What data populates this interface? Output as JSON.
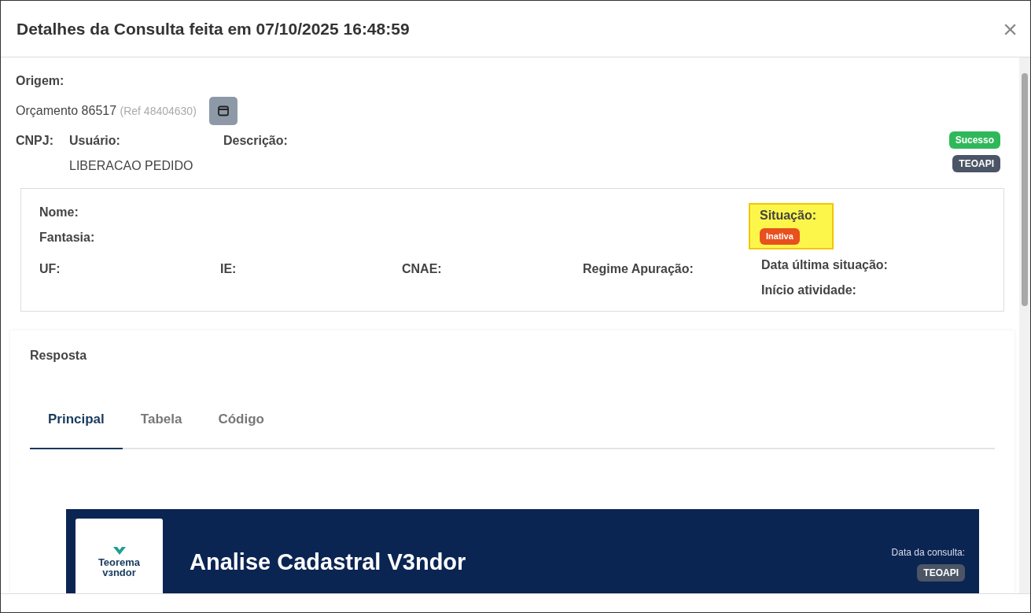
{
  "modal": {
    "title": "Detalhes da Consulta feita em 07/10/2025 16:48:59",
    "close": "×"
  },
  "origin": {
    "label": "Origem:",
    "value": "Orçamento 86517",
    "ref": "(Ref 48404630)"
  },
  "fields": [
    {
      "label": "CNPJ:"
    },
    {
      "label": "Usuário:",
      "value": "LIBERACAO PEDIDO"
    },
    {
      "label": "Descrição:"
    }
  ],
  "badges": [
    {
      "text": "Sucesso",
      "color": "#2fb85a"
    },
    {
      "text": "TEOAPI",
      "color": "#4b5566"
    }
  ],
  "company": {
    "rows": [
      [
        "Nome:"
      ],
      [
        "Fantasia:"
      ],
      [
        "UF:",
        "IE:",
        "CNAE:",
        "Regime Apuração:"
      ]
    ],
    "situation": {
      "label": "Situação:",
      "status": "Inativa",
      "color": "#e8501e",
      "highlighted": true
    },
    "extra": [
      "Data última situação:",
      "Início atividade:"
    ]
  },
  "response": {
    "title": "Resposta",
    "tabs": [
      {
        "label": "Principal",
        "selected": true
      },
      {
        "label": "Tabela",
        "selected": false
      },
      {
        "label": "Código",
        "selected": false
      }
    ],
    "report": {
      "logo": [
        "Teorema",
        "vɜndor"
      ],
      "title": "Analise Cadastral V3ndor",
      "date_label": "Data da consulta:",
      "source": "TEOAPI"
    }
  }
}
